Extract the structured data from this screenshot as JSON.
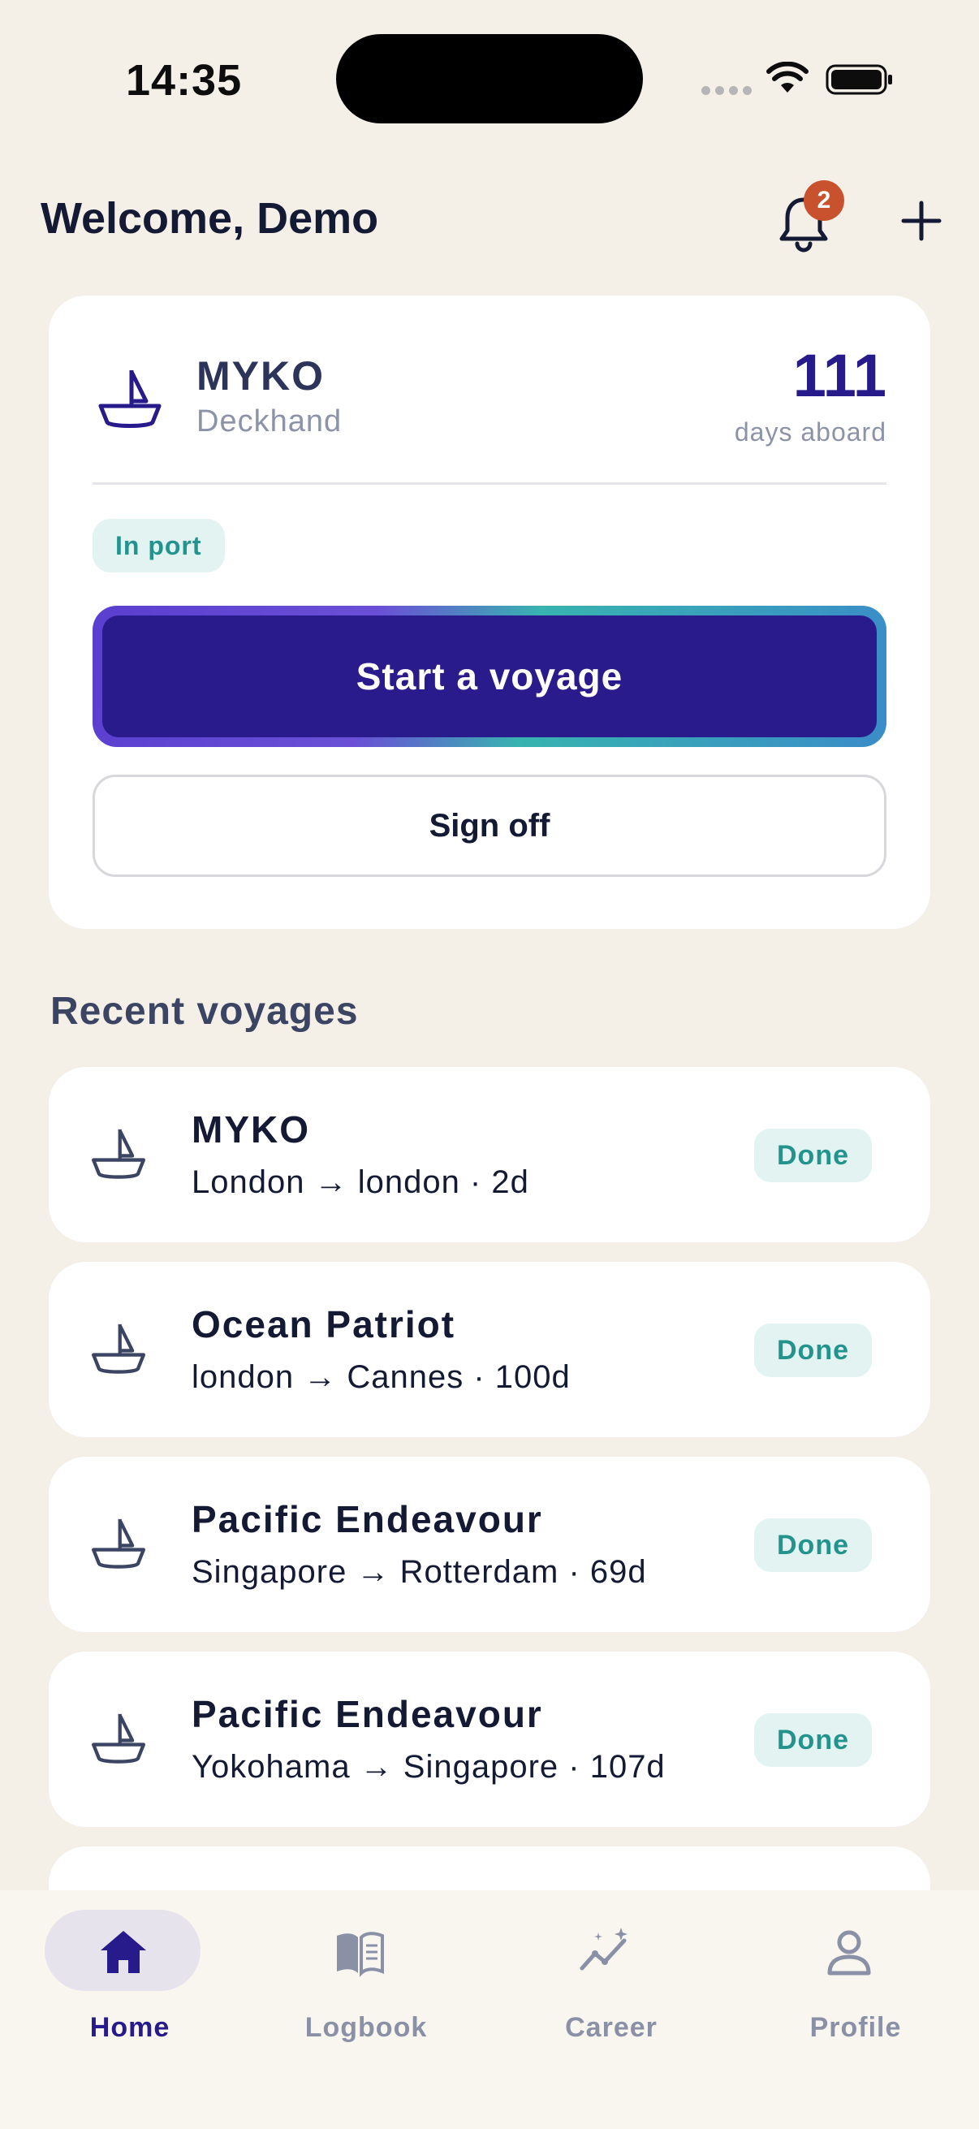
{
  "status_bar": {
    "time": "14:35"
  },
  "header": {
    "title": "Welcome, Demo",
    "notification_count": "2"
  },
  "current": {
    "vessel": "MYKO",
    "role": "Deckhand",
    "days_value": "111",
    "days_label": "days aboard",
    "status": "In port",
    "start_label": "Start a voyage",
    "signoff_label": "Sign off"
  },
  "recent": {
    "title": "Recent voyages",
    "items": [
      {
        "vessel": "MYKO",
        "route": "London → london · 2d",
        "status": "Done"
      },
      {
        "vessel": "Ocean Patriot",
        "route": "london → Cannes · 100d",
        "status": "Done"
      },
      {
        "vessel": "Pacific Endeavour",
        "route": "Singapore → Rotterdam · 69d",
        "status": "Done"
      },
      {
        "vessel": "Pacific Endeavour",
        "route": "Yokohama → Singapore · 107d",
        "status": "Done"
      }
    ]
  },
  "nav": {
    "items": [
      {
        "label": "Home",
        "icon": "home-icon",
        "active": true
      },
      {
        "label": "Logbook",
        "icon": "book-icon",
        "active": false
      },
      {
        "label": "Career",
        "icon": "career-chart-icon",
        "active": false
      },
      {
        "label": "Profile",
        "icon": "person-icon",
        "active": false
      }
    ]
  },
  "colors": {
    "accent": "#271a8a",
    "teal": "#23938e",
    "badge": "#c8522e",
    "background": "#f4f0e8"
  }
}
